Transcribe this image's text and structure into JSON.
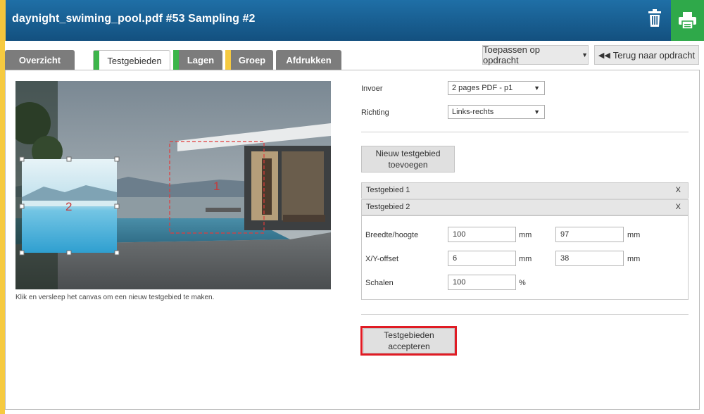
{
  "header": {
    "title": "daynight_swiming_pool.pdf #53 Sampling #2",
    "trash_icon": "trash-icon",
    "print_icon": "printer-icon",
    "brand_color": "#1a5f93",
    "print_color": "#2fa94a"
  },
  "tabs": [
    {
      "label": "Overzicht",
      "active": false,
      "marker": ""
    },
    {
      "label": "Testgebieden",
      "active": true,
      "marker": "#3cb54a"
    },
    {
      "label": "Lagen",
      "active": false,
      "marker": "#3cb54a"
    },
    {
      "label": "Groep",
      "active": false,
      "marker": "#f6ca40"
    },
    {
      "label": "Afdrukken",
      "active": false,
      "marker": ""
    }
  ],
  "toolbar": {
    "apply_label": "Toepassen op opdracht",
    "back_label": "Terug naar opdracht"
  },
  "canvas": {
    "hint": "Klik en versleep het canvas om een nieuw testgebied te maken.",
    "area1_label": "1",
    "area2_label": "2"
  },
  "form": {
    "invoer_label": "Invoer",
    "invoer_value": "2 pages PDF - p1",
    "richting_label": "Richting",
    "richting_value": "Links-rechts",
    "new_area_label": "Nieuw testgebied toevoegen",
    "areas": [
      {
        "title": "Testgebied 1",
        "close": "X"
      },
      {
        "title": "Testgebied 2",
        "close": "X"
      }
    ],
    "size_label": "Breedte/hoogte",
    "width": "100",
    "height": "97",
    "offset_label": "X/Y-offset",
    "x_offset": "6",
    "y_offset": "38",
    "scale_label": "Schalen",
    "scale": "100",
    "unit_mm": "mm",
    "unit_pct": "%",
    "accept_label": "Testgebieden accepteren"
  }
}
